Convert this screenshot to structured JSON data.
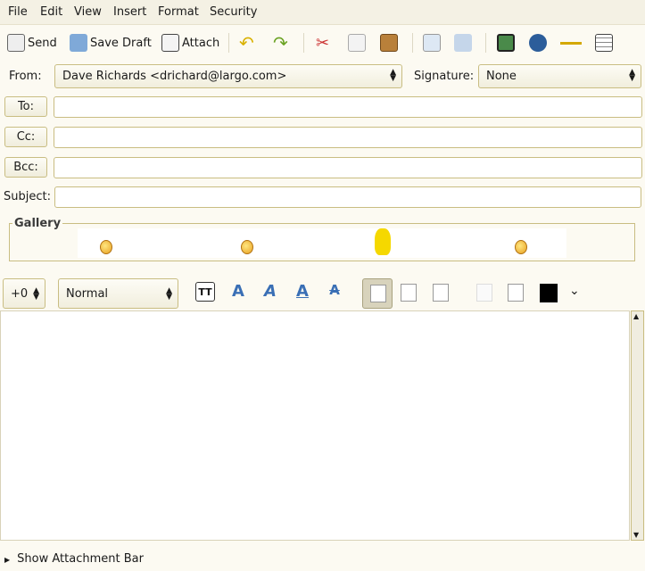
{
  "menu": [
    "File",
    "Edit",
    "View",
    "Insert",
    "Format",
    "Security"
  ],
  "toolbar": {
    "send": "Send",
    "save_draft": "Save Draft",
    "attach": "Attach"
  },
  "from": {
    "label": "From:",
    "value": "Dave Richards <drichard@largo.com>"
  },
  "signature": {
    "label": "Signature:",
    "value": "None"
  },
  "to": {
    "label": "To:",
    "value": ""
  },
  "cc": {
    "label": "Cc:",
    "value": ""
  },
  "bcc": {
    "label": "Bcc:",
    "value": ""
  },
  "subject": {
    "label": "Subject:",
    "value": ""
  },
  "gallery": {
    "title": "Gallery",
    "items": [
      "angel-smiley",
      "smiley",
      "dancing-banana",
      "grin-smiley"
    ]
  },
  "format": {
    "size": "+0",
    "style": "Normal",
    "color": "#000000",
    "active_align": "left"
  },
  "editor": {
    "body": ""
  },
  "footer": {
    "attachment_bar": "Show Attachment Bar"
  }
}
